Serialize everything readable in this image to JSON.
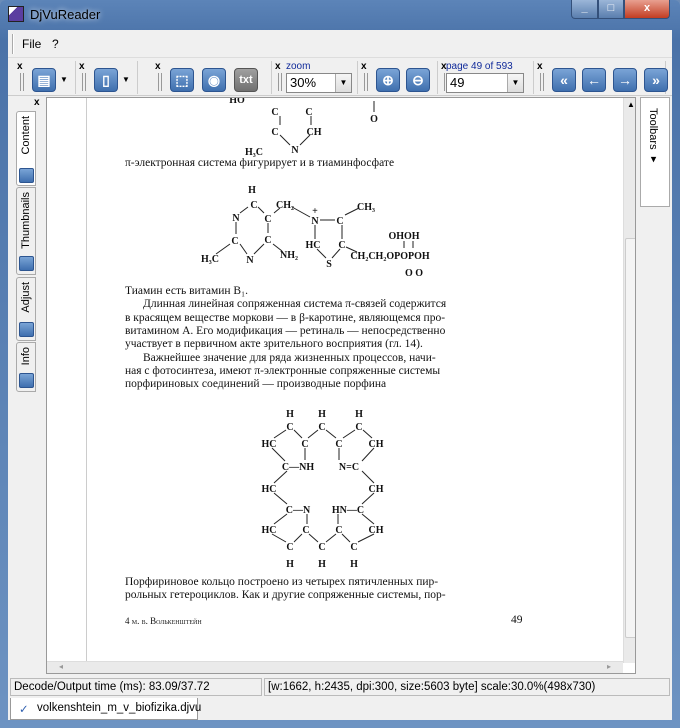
{
  "window": {
    "title": "DjVuReader",
    "minimize": "_",
    "maximize": "□",
    "close": "x"
  },
  "menu": [
    "File",
    "?"
  ],
  "toolbar": {
    "close": "x",
    "zoom_label": "zoom",
    "zoom_value": "30%",
    "page_label": "page 49 of 593",
    "page_value": "49",
    "txt": "txt"
  },
  "sidebar": {
    "close": "x",
    "tabs": [
      "Content",
      "Thumbnails",
      "Adjust",
      "Info"
    ]
  },
  "right_dock": {
    "label": "Toolbars ▾"
  },
  "page": {
    "line1": "π-электронная система фигурирует и в тиаминфосфате",
    "para": [
      "Тиамин есть витамин B₁.",
      "Длинная линейная сопряженная система π-связей содержится",
      "в красящем веществе моркови — в β-каротине, являющемся про-",
      "витамином А. Его модификация — ретиналь — непосредственно",
      "участвует в первичном акте зрительного восприятия (гл. 14).",
      "Важнейшее значение для ряда жизненных процессов, начи-",
      "ная с фотосинтеза, имеют π-электронные сопряженные системы",
      "порфириновых соединений — производные порфина"
    ],
    "para2": [
      "Порфириновое кольцо построено из четырех пятичленных пир-",
      "рольных гетероциклов. Как и другие сопряженные системы, пор-"
    ],
    "footer_left": "4  м. в. Волькенштейн",
    "footer_right": "49",
    "fig_top": [
      "HO",
      "C",
      "C",
      "O",
      "C",
      "CH",
      "H₃C",
      "N"
    ],
    "fig_thiamine": [
      "H",
      "C",
      "CH₂",
      "N",
      "C",
      "N",
      "+",
      "C",
      "CH₃",
      "HC",
      "C",
      "C",
      "C",
      "OHOH",
      "H₃C",
      "N",
      "NH₂",
      "S",
      "CH₂CH₂OPOPOH",
      "O O"
    ],
    "fig_porphine": [
      "H",
      "H",
      "H",
      "C",
      "C",
      "C",
      "HC",
      "C",
      "C",
      "CH",
      "C—NH",
      "N=C",
      "HC",
      "CH",
      "C—N",
      "HN—C",
      "HC",
      "C",
      "C",
      "CH",
      "C",
      "C",
      "C",
      "H",
      "H",
      "H"
    ]
  },
  "status": {
    "left": "Decode/Output time (ms): 83.09/37.72",
    "right": "[w:1662, h:2435, dpi:300, size:5603 byte] scale:30.0%(498x730)"
  },
  "doc_tab": {
    "label": "volkenshtein_m_v_biofizika.djvu"
  }
}
